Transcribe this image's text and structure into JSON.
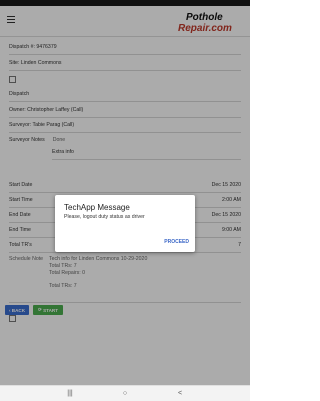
{
  "app": {
    "logo_line1": "Pothole",
    "logo_line2": "Repair.com"
  },
  "details": {
    "dispatch_number": "Dispatch #: 9476379",
    "site": "Site: Linden Commons",
    "dispatch_label": "Dispatch",
    "owner": "Owner: Christopher Laffey (Call)",
    "surveyor": "Surveyor: Tabie Parag (Call)",
    "surveyor_notes_label": "Surveyor Notes",
    "surveyor_notes_value": "Done",
    "extra_info": "Extra info",
    "start_date_label": "Start Date",
    "start_date_value": "Dec 15 2020",
    "start_time_label": "Start Time",
    "start_time_value": "2:00 AM",
    "end_date_label": "End Date",
    "end_date_value": "Dec 15 2020",
    "end_time_label": "End Time",
    "end_time_value": "9:00 AM",
    "total_trs_label": "Total TR's",
    "total_trs_value": "7",
    "schedule_note_label": "Schedule Note",
    "schedule_note_line1": "Tech info for Linden Commons 10-29-2020",
    "schedule_note_line2": "Total TRs: 7",
    "schedule_note_line3": "Total Repairs: 0",
    "schedule_note_line4": "Total TRs: 7"
  },
  "buttons": {
    "back": "BACK",
    "start": "START"
  },
  "dialog": {
    "title": "TechApp Message",
    "message": "Please, logout duty status as driver",
    "action": "PROCEED"
  },
  "colors": {
    "back_button": "#3b6fd1",
    "start_button": "#4caf50",
    "dialog_action": "#3b67c7",
    "logo_text": "#111111",
    "logo_accent": "#c0392b"
  },
  "navbar": {
    "recent_icon": "|||",
    "home_icon": "○",
    "back_icon": "<"
  }
}
